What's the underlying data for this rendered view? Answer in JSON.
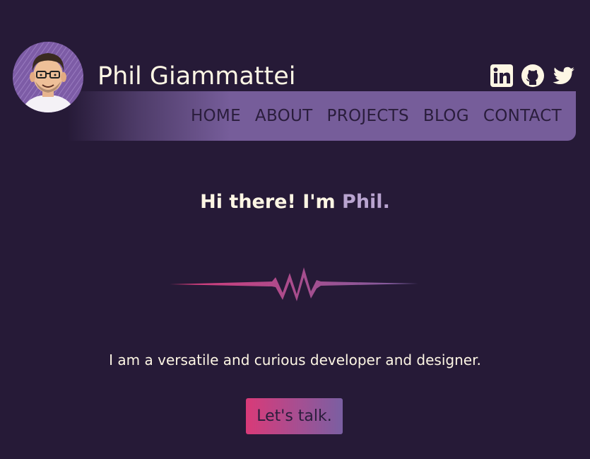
{
  "header": {
    "site_name": "Phil Giammattei",
    "avatar_icon": "avatar-caricature",
    "socials": [
      {
        "name": "linkedin-icon"
      },
      {
        "name": "github-icon"
      },
      {
        "name": "twitter-icon"
      }
    ]
  },
  "nav": {
    "items": [
      {
        "label": "HOME"
      },
      {
        "label": "ABOUT"
      },
      {
        "label": "PROJECTS"
      },
      {
        "label": "BLOG"
      },
      {
        "label": "CONTACT"
      }
    ]
  },
  "hero": {
    "greeting_prefix": "Hi there! I'm ",
    "greeting_name": "Phil.",
    "tagline": "I am a versatile and curious developer and designer.",
    "cta_label": "Let's talk."
  },
  "colors": {
    "background": "#261a37",
    "nav_bar": "#765d9a",
    "text": "#fdf6e4",
    "accent": "#b9a4d0",
    "cta_start": "#d93a78",
    "cta_end": "#7a5fa2"
  }
}
